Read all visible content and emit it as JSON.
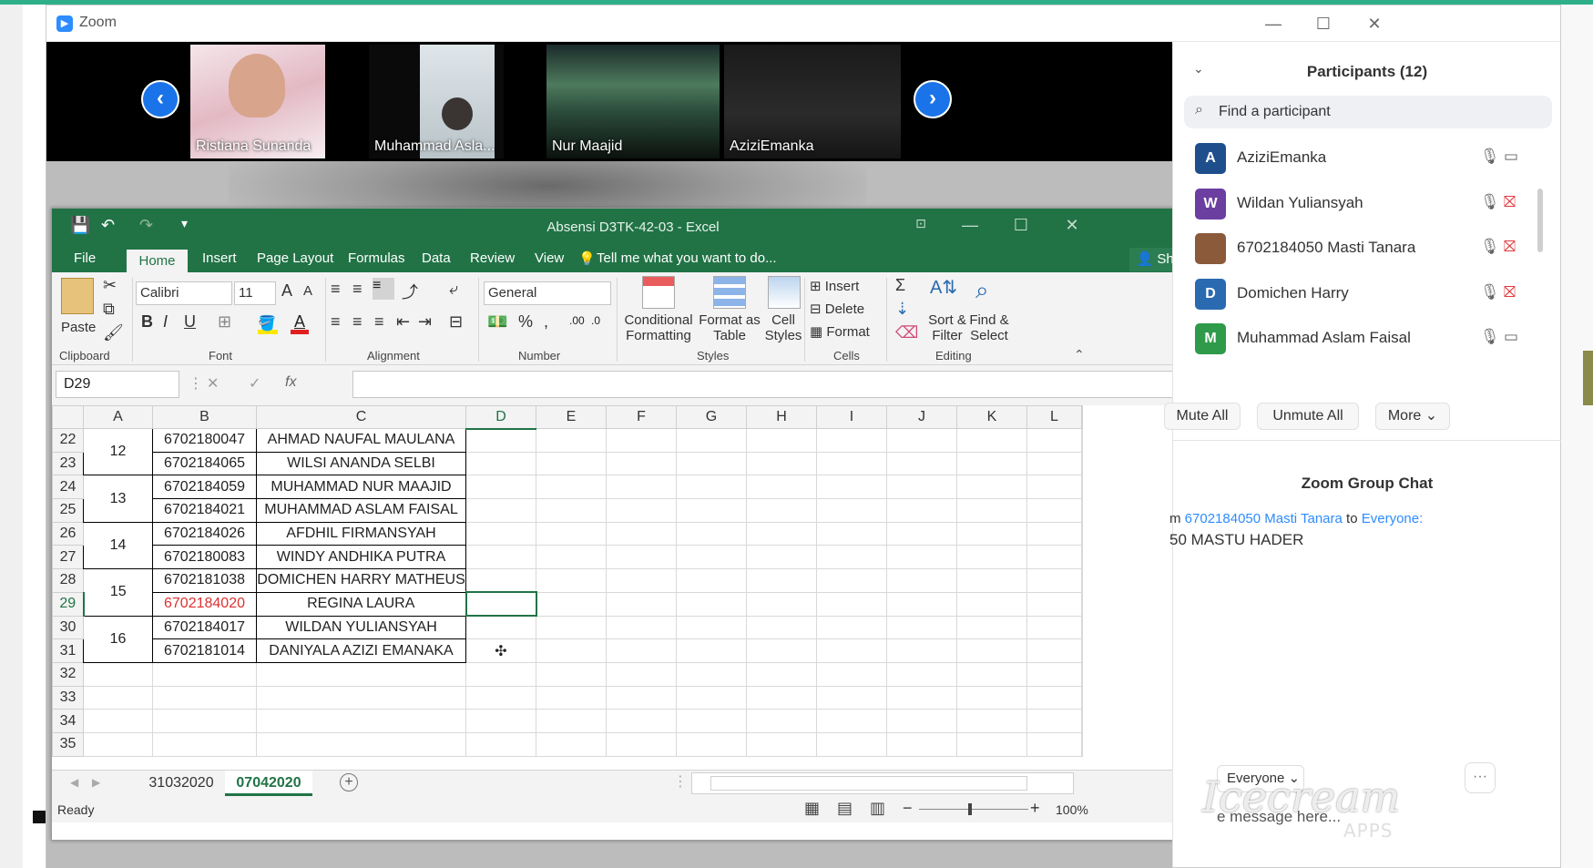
{
  "zoom": {
    "title": "Zoom",
    "gallery": [
      {
        "name": "Ristiana Sunanda"
      },
      {
        "name": "Muhammad Asla..."
      },
      {
        "name": "Nur Maajid"
      },
      {
        "name": "AziziEmanka"
      }
    ]
  },
  "excel": {
    "title": "Absensi D3TK-42-03 - Excel",
    "tabs": [
      "File",
      "Home",
      "Insert",
      "Page Layout",
      "Formulas",
      "Data",
      "Review",
      "View"
    ],
    "tell_me": "Tell me what you want to do...",
    "share": "Share",
    "ribbon": {
      "clipboard": {
        "group": "Clipboard",
        "paste": "Paste"
      },
      "font": {
        "group": "Font",
        "name": "Calibri",
        "size": "11",
        "bold": "B",
        "italic": "I",
        "underline": "U"
      },
      "alignment": {
        "group": "Alignment"
      },
      "number": {
        "group": "Number",
        "format": "General",
        "percent": "%"
      },
      "styles": {
        "group": "Styles",
        "conditional": "Conditional",
        "formatting": "Formatting",
        "format_as": "Format as",
        "table": "Table",
        "cell": "Cell",
        "cell_styles": "Styles"
      },
      "cells": {
        "group": "Cells",
        "insert": "Insert",
        "delete": "Delete",
        "format": "Format"
      },
      "editing": {
        "group": "Editing",
        "sort": "Sort &",
        "filter": "Filter",
        "find": "Find &",
        "select": "Select"
      }
    },
    "name_box": "D29",
    "fx": "fx",
    "columns": [
      "A",
      "B",
      "C",
      "D",
      "E",
      "F",
      "G",
      "H",
      "I",
      "J",
      "K",
      "L"
    ],
    "rows": [
      {
        "n": "22",
        "a": "12",
        "b": "6702180047",
        "c": "AHMAD NAUFAL MAULANA"
      },
      {
        "n": "23",
        "a": "",
        "b": "6702184065",
        "c": "WILSI ANANDA SELBI"
      },
      {
        "n": "24",
        "a": "13",
        "b": "6702184059",
        "c": "MUHAMMAD NUR MAAJID"
      },
      {
        "n": "25",
        "a": "",
        "b": "6702184021",
        "c": "MUHAMMAD ASLAM FAISAL"
      },
      {
        "n": "26",
        "a": "14",
        "b": "6702184026",
        "c": "AFDHIL FIRMANSYAH"
      },
      {
        "n": "27",
        "a": "",
        "b": "6702180083",
        "c": "WINDY ANDHIKA PUTRA"
      },
      {
        "n": "28",
        "a": "15",
        "b": "6702181038",
        "c": "DOMICHEN HARRY MATHEUS"
      },
      {
        "n": "29",
        "a": "",
        "b": "6702184020",
        "c": "REGINA LAURA"
      },
      {
        "n": "30",
        "a": "16",
        "b": "6702184017",
        "c": "WILDAN YULIANSYAH"
      },
      {
        "n": "31",
        "a": "",
        "b": "6702181014",
        "c": "DANIYALA AZIZI EMANAKA"
      },
      {
        "n": "32",
        "a": "",
        "b": "",
        "c": ""
      },
      {
        "n": "33",
        "a": "",
        "b": "",
        "c": ""
      },
      {
        "n": "34",
        "a": "",
        "b": "",
        "c": ""
      },
      {
        "n": "35",
        "a": "",
        "b": "",
        "c": ""
      }
    ],
    "sheets": [
      "31032020",
      "07042020"
    ],
    "status": "Ready",
    "zoom_level": "100%"
  },
  "participants": {
    "title": "Participants (12)",
    "search_placeholder": "Find a participant",
    "list": [
      {
        "initial": "A",
        "name": "AziziEmanka",
        "color": "#1f4e8c",
        "video_off": false
      },
      {
        "initial": "W",
        "name": "Wildan Yuliansyah",
        "color": "#6b3fa0",
        "video_off": true
      },
      {
        "initial": "",
        "name": "6702184050 Masti Tanara",
        "color": "#8a5a3a",
        "video_off": true
      },
      {
        "initial": "D",
        "name": "Domichen Harry",
        "color": "#2a6ab0",
        "video_off": true
      },
      {
        "initial": "M",
        "name": "Muhammad Aslam Faisal",
        "color": "#2e9a4a",
        "video_off": false
      }
    ],
    "mute_all": "Mute All",
    "unmute_all": "Unmute All",
    "more": "More"
  },
  "chat": {
    "title": "Zoom Group Chat",
    "from_prefix": "m",
    "from": "6702184050 Masti Tanara",
    "to_word": "to",
    "to": "Everyone:",
    "message": "50 MASTU HADER",
    "recipient": "Everyone",
    "input_placeholder": "e message here..."
  },
  "watermark": {
    "brand": "Icecream",
    "apps": "APPS"
  }
}
